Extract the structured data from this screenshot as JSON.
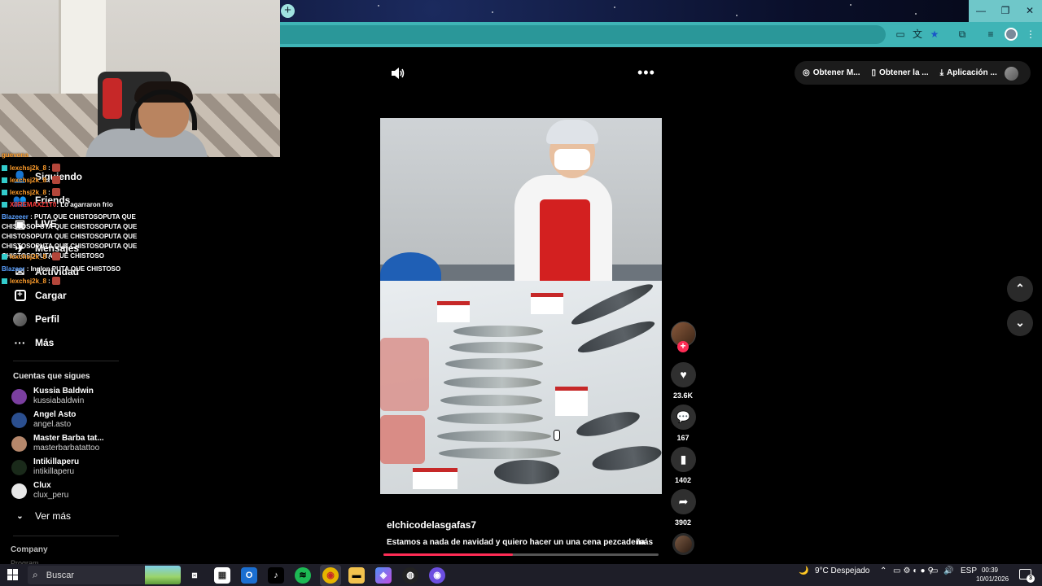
{
  "browser": {
    "new_tab_glyph": "+",
    "window_controls": [
      "—",
      "❐",
      "✕"
    ],
    "toolbar_icons": [
      "cast-icon",
      "translate-icon",
      "bookmark-star-icon",
      "extensions-icon",
      "media-icon",
      "profile-avatar",
      "kebab-menu-icon"
    ]
  },
  "stream_chat": [
    {
      "user": "guevona",
      "text": ""
    },
    {
      "user": "lexchsj2k_8",
      "text": ":"
    },
    {
      "user": "lexchsj2k_8",
      "text": ":"
    },
    {
      "user": "lexchsj2k_8",
      "text": ":"
    },
    {
      "user": "X0REMAXZ1T0",
      "text": ": Lo agarraron frio"
    },
    {
      "user": "Blazeeer",
      "text": ": PUTA QUE CHISTOSOPUTA QUE CHISTOSOPUTA QUE CHISTOSOPUTA QUE CHISTOSOPUTA QUE CHISTOSOPUTA QUE CHISTOSOPUTA QUE CHISTOSOPUTA QUE CHISTOSOPUTA QUE CHISTOSO"
    },
    {
      "user": "lexchsj2k_8",
      "text": ":"
    },
    {
      "user": "Blazeer",
      "text": ": Inglon PUTA QUE CHISTOSO"
    },
    {
      "user": "lexchsj2k_8",
      "text": ":"
    }
  ],
  "sidebar": {
    "nav": [
      {
        "label": "Siguiendo",
        "icon": "following-icon"
      },
      {
        "label": "Friends",
        "icon": "friends-icon"
      },
      {
        "label": "LIVE",
        "icon": "live-icon"
      },
      {
        "label": "Mensajes",
        "icon": "messages-icon"
      },
      {
        "label": "Actividad",
        "icon": "activity-icon"
      },
      {
        "label": "Cargar",
        "icon": "upload-icon"
      },
      {
        "label": "Perfil",
        "icon": "profile-avatar"
      },
      {
        "label": "Más",
        "icon": "more-icon"
      }
    ],
    "following_title": "Cuentas que sigues",
    "following": [
      {
        "name": "Kussia Baldwin",
        "handle": "kussiabaldwin",
        "color": "#7b3fa0"
      },
      {
        "name": "Angel Asto",
        "handle": "angel.asto",
        "color": "#2b4f8f"
      },
      {
        "name": "Master Barba tat...",
        "handle": "masterbarbatattoo",
        "color": "#b5876b"
      },
      {
        "name": "Intikillaperu",
        "handle": "intikillaperu",
        "color": "#1a2a1a"
      },
      {
        "name": "Clux",
        "handle": "clux_peru",
        "color": "#e8e8e8"
      }
    ],
    "see_more": "Ver más",
    "company": "Company",
    "program": "Program"
  },
  "header": {
    "buttons": [
      {
        "label": "Obtener M...",
        "icon": "coin-icon"
      },
      {
        "label": "Obtener la ...",
        "icon": "phone-icon"
      },
      {
        "label": "Aplicación ...",
        "icon": "download-icon"
      }
    ]
  },
  "video": {
    "author": "elchicodelasgafas7",
    "caption": "Estamos a nada de navidad y quiero hacer un una cena pezcadeña",
    "more_label": "más",
    "progress": 0.47
  },
  "actions": {
    "likes": "23.6K",
    "comments": "167",
    "saves": "1402",
    "shares": "3902"
  },
  "taskbar": {
    "search_placeholder": "Buscar",
    "weather": "9°C  Despejado",
    "language": "ESP",
    "time": "00:39",
    "date": "10/01/2026",
    "notifications": "3"
  },
  "colors": {
    "accent": "#fe2c55",
    "toolbar": "#3fb4b6",
    "background": "#000000"
  }
}
